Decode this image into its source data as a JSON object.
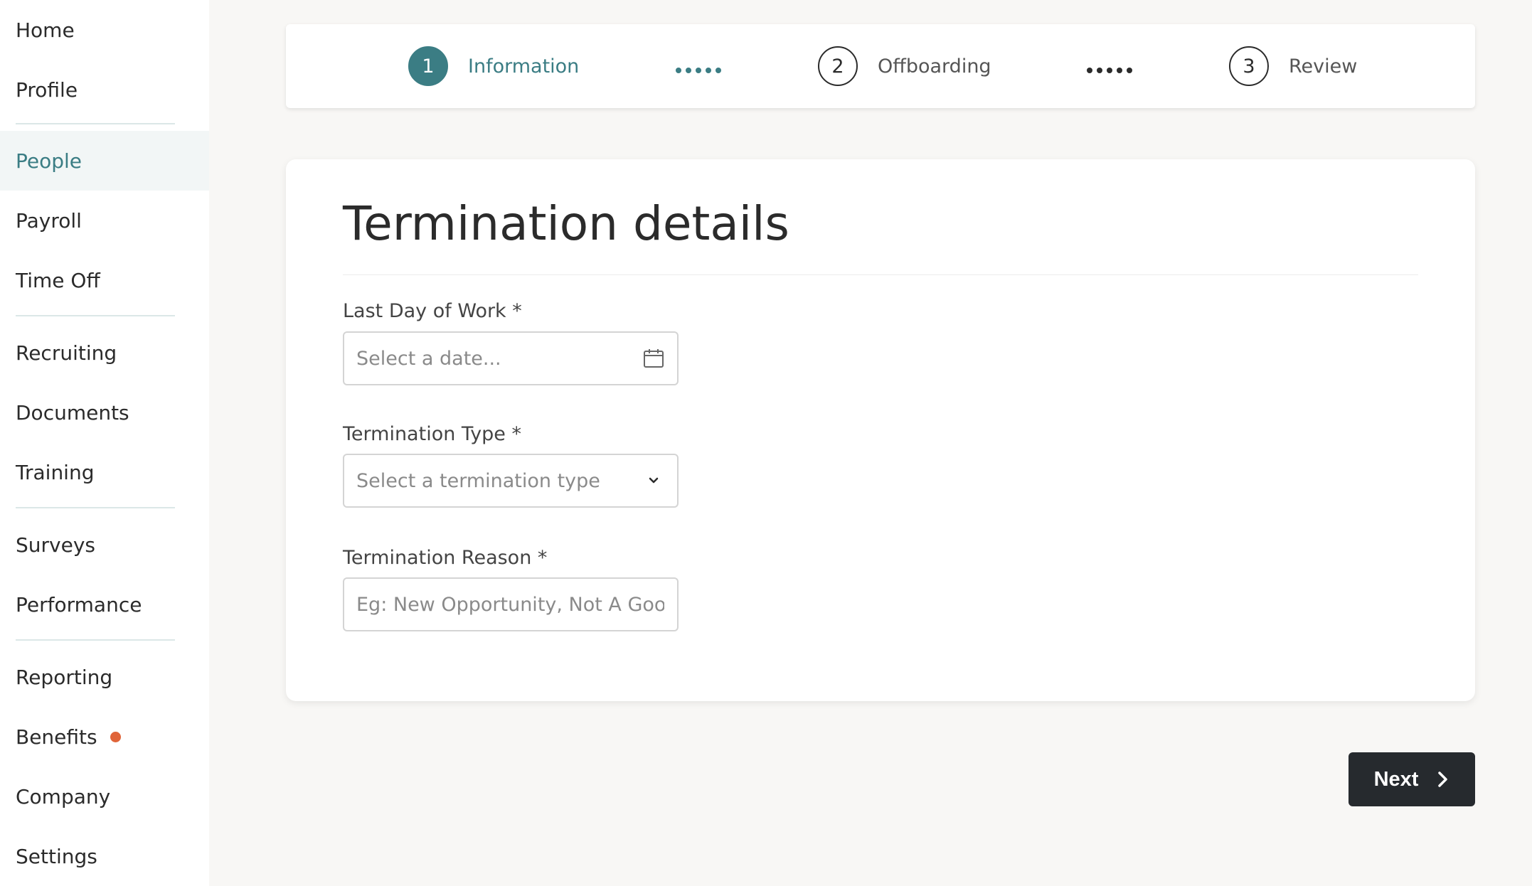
{
  "sidebar": {
    "items": [
      {
        "label": "Home",
        "active": false
      },
      {
        "label": "Profile",
        "active": false
      },
      {
        "label": "People",
        "active": true
      },
      {
        "label": "Payroll",
        "active": false
      },
      {
        "label": "Time Off",
        "active": false
      },
      {
        "label": "Recruiting",
        "active": false
      },
      {
        "label": "Documents",
        "active": false
      },
      {
        "label": "Training",
        "active": false
      },
      {
        "label": "Surveys",
        "active": false
      },
      {
        "label": "Performance",
        "active": false
      },
      {
        "label": "Reporting",
        "active": false
      },
      {
        "label": "Benefits",
        "active": false,
        "badge": "notification-dot"
      },
      {
        "label": "Company",
        "active": false
      },
      {
        "label": "Settings",
        "active": false
      }
    ]
  },
  "stepper": {
    "steps": [
      {
        "number": "1",
        "label": "Information",
        "state": "active"
      },
      {
        "number": "2",
        "label": "Offboarding",
        "state": "upcoming"
      },
      {
        "number": "3",
        "label": "Review",
        "state": "upcoming"
      }
    ]
  },
  "form": {
    "title": "Termination details",
    "last_day": {
      "label": "Last Day of Work *",
      "placeholder": "Select a date...",
      "icon": "calendar-icon"
    },
    "termination_type": {
      "label": "Termination Type *",
      "placeholder": "Select a termination type",
      "icon": "chevron-down-icon"
    },
    "termination_reason": {
      "label": "Termination Reason *",
      "placeholder": "Eg: New Opportunity, Not A Good Fit"
    }
  },
  "actions": {
    "next_label": "Next",
    "next_icon": "chevron-right-icon"
  },
  "colors": {
    "accent": "#3b7d84",
    "button": "#262a2e",
    "badge": "#e06439"
  }
}
